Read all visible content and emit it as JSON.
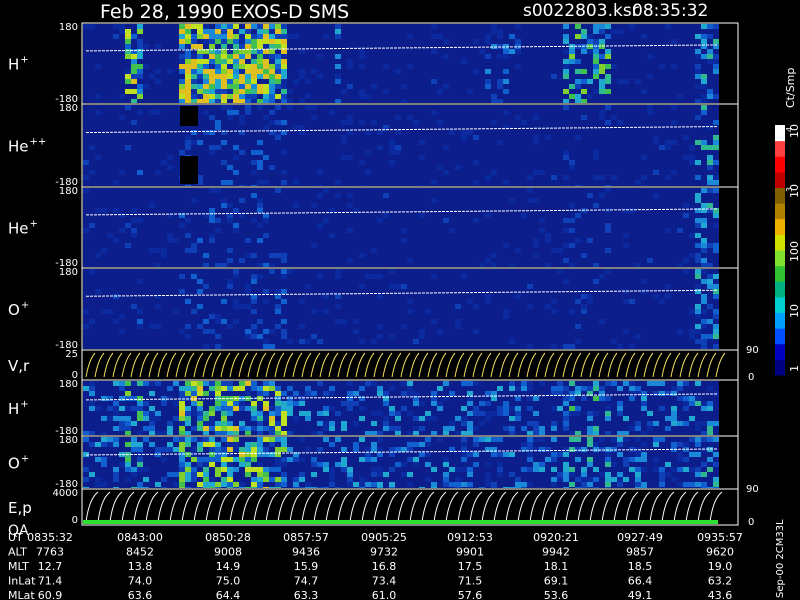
{
  "header": {
    "title": "Feb 28, 1990   EXOS-D SMS",
    "file": "s0022803.ksr",
    "time": "08:35:32"
  },
  "panels": [
    {
      "id": "hplus",
      "label": "H",
      "sup": "+",
      "ticks": [
        "180",
        "-180"
      ]
    },
    {
      "id": "heplusplus",
      "label": "He",
      "sup": "++",
      "ticks": [
        "180",
        "-180"
      ]
    },
    {
      "id": "heplus",
      "label": "He",
      "sup": "+",
      "ticks": [
        "180",
        "-180"
      ]
    },
    {
      "id": "oplus",
      "label": "O",
      "sup": "+",
      "ticks": [
        "180",
        "-180"
      ]
    },
    {
      "id": "vr",
      "label": "V,r",
      "sup": "",
      "ticks": [
        "25",
        "0"
      ],
      "right_ticks": [
        "90",
        "0"
      ]
    },
    {
      "id": "hplus2",
      "label": "H",
      "sup": "+",
      "ticks": [
        "180",
        "-180"
      ]
    },
    {
      "id": "oplus2",
      "label": "O",
      "sup": "+",
      "ticks": [
        "180",
        "-180"
      ]
    },
    {
      "id": "ep",
      "label": "E,p",
      "sup": "",
      "label2": "QA",
      "ticks": [
        "4000",
        "0"
      ],
      "right_ticks": [
        "90",
        "0"
      ]
    }
  ],
  "colorbar": {
    "unit": "Ct/Smp",
    "labels": [
      "10",
      "4",
      "10",
      "3",
      "100",
      "10",
      "1"
    ],
    "colors": [
      "#00007f",
      "#0000c0",
      "#0050ff",
      "#00a0ff",
      "#00d0d0",
      "#00b080",
      "#30c030",
      "#80e030",
      "#d0e000",
      "#f0b000",
      "#b08000",
      "#806000",
      "#c00000",
      "#ff0000",
      "#ff4040",
      "#ffffff"
    ]
  },
  "footer": {
    "vertical_text": "Sep-00 2CM33L",
    "rows": [
      {
        "name": "UT",
        "values": [
          "0835:32",
          "0843:00",
          "0850:28",
          "0857:57",
          "0905:25",
          "0912:53",
          "0920:21",
          "0927:49",
          "0935:57"
        ]
      },
      {
        "name": "ALT",
        "values": [
          "7763",
          "8452",
          "9008",
          "9436",
          "9732",
          "9901",
          "9942",
          "9857",
          "9620"
        ]
      },
      {
        "name": "MLT",
        "values": [
          "12.7",
          "13.8",
          "14.9",
          "15.9",
          "16.8",
          "17.5",
          "18.1",
          "18.5",
          "19.0"
        ]
      },
      {
        "name": "InLat",
        "values": [
          "71.4",
          "74.0",
          "75.0",
          "74.7",
          "73.4",
          "71.5",
          "69.1",
          "66.4",
          "63.2"
        ]
      },
      {
        "name": "MLat",
        "values": [
          "60.9",
          "63.6",
          "64.4",
          "63.3",
          "61.0",
          "57.6",
          "53.6",
          "49.1",
          "43.6"
        ]
      }
    ]
  },
  "chart_data": {
    "type": "heatmap",
    "title": "Feb 28, 1990   EXOS-D SMS",
    "x": [
      "0835:32",
      "0843:00",
      "0850:28",
      "0857:57",
      "0905:25",
      "0912:53",
      "0920:21",
      "0927:49",
      "0935:57"
    ],
    "xlabel": "UT",
    "series": [
      {
        "name": "H+",
        "ylim": [
          -180,
          180
        ]
      },
      {
        "name": "He++",
        "ylim": [
          -180,
          180
        ]
      },
      {
        "name": "He+",
        "ylim": [
          -180,
          180
        ]
      },
      {
        "name": "O+",
        "ylim": [
          -180,
          180
        ]
      },
      {
        "name": "V,r",
        "ylim": [
          0,
          25
        ]
      },
      {
        "name": "H+",
        "ylim": [
          -180,
          180
        ]
      },
      {
        "name": "O+",
        "ylim": [
          -180,
          180
        ]
      },
      {
        "name": "E,p",
        "ylim": [
          0,
          4000
        ]
      }
    ],
    "colorbar_unit": "Ct/Smp",
    "grid": false
  }
}
